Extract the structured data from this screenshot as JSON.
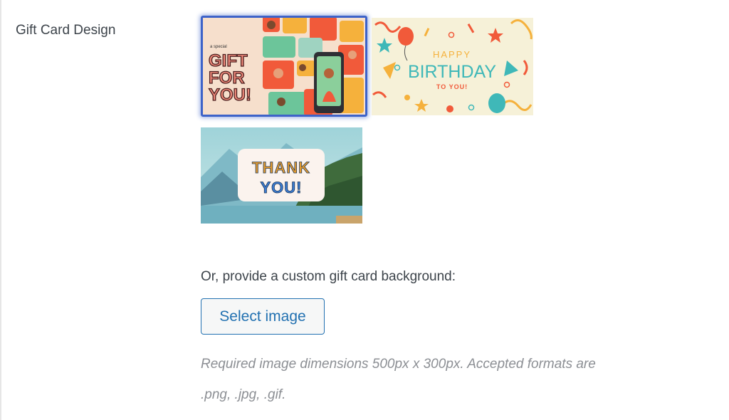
{
  "field": {
    "label": "Gift Card Design"
  },
  "designs": [
    {
      "name": "gift-for-you",
      "small_text": "a special",
      "lines": [
        "GIFT",
        "FOR",
        "YOU!"
      ],
      "selected": true
    },
    {
      "name": "happy-birthday",
      "lines": [
        "HAPPY",
        "BIRTHDAY",
        "TO YOU!"
      ],
      "selected": false
    },
    {
      "name": "thank-you",
      "lines": [
        "THANK",
        "YOU!"
      ],
      "selected": false
    }
  ],
  "custom": {
    "prompt": "Or, provide a custom gift card background:",
    "button_label": "Select image",
    "help_line1": "Required image dimensions 500px x 300px. Accepted formats are",
    "help_line2": ".png, .jpg, .gif."
  },
  "colors": {
    "accent": "#2271b1",
    "selected_border": "#3d63c9",
    "help_text": "#8c8f94"
  }
}
